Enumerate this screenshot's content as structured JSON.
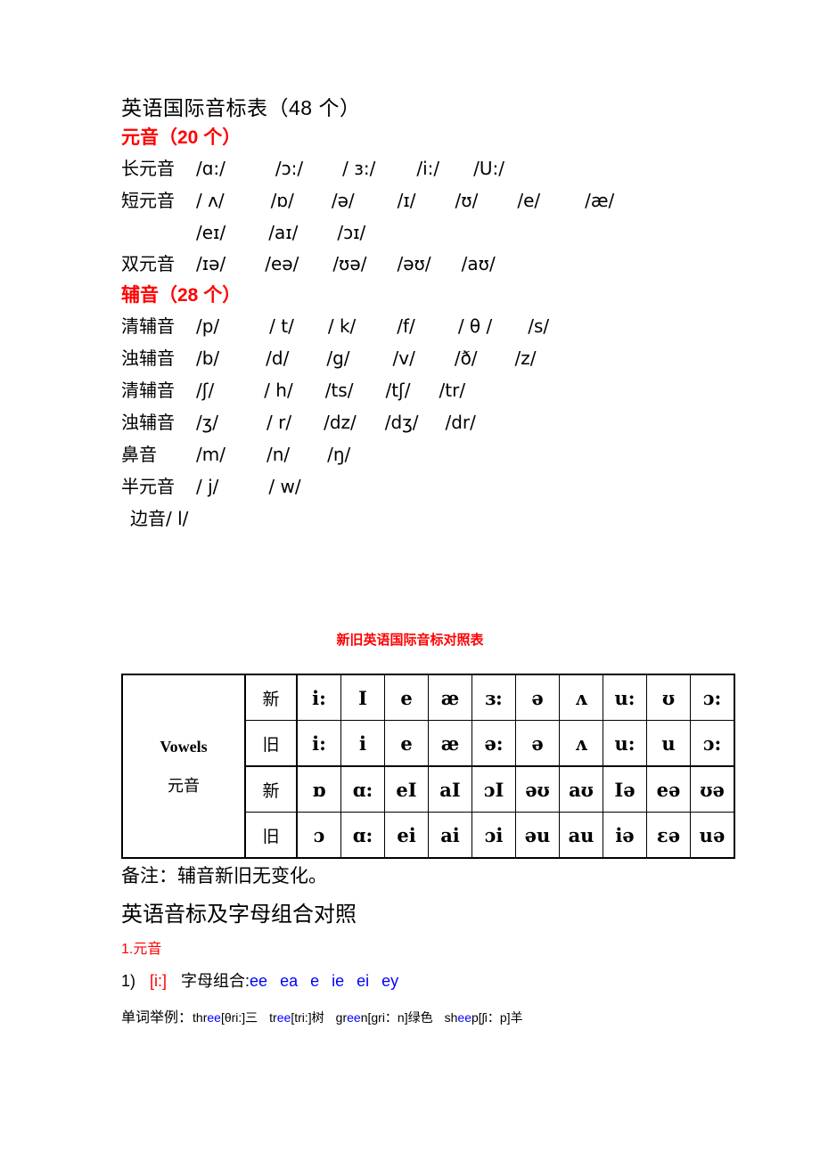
{
  "document": {
    "title": "英语国际音标表（48 个）",
    "vowels_heading": "元音（20 个）",
    "consonants_heading": "辅音（28 个）",
    "vowel_rows": [
      {
        "label": "长元音",
        "symbols": [
          "/ɑ:/",
          "/ɔ:/",
          "/ ɜ:/",
          "/i:/",
          "/U:/"
        ]
      },
      {
        "label": "短元音",
        "symbols": [
          "/ ʌ/",
          "/ɒ/",
          "/ə/",
          "/ɪ/",
          "/ʊ/",
          "/e/",
          "/æ/"
        ]
      },
      {
        "label": "",
        "symbols": [
          "/eɪ/",
          "/aɪ/",
          "/ɔɪ/"
        ]
      },
      {
        "label": "双元音",
        "symbols": [
          "/ɪə/",
          "/eə/",
          "/ʊə/",
          "/əʊ/",
          "/aʊ/"
        ]
      }
    ],
    "consonant_rows": [
      {
        "label": "清辅音",
        "symbols": [
          "/p/",
          "/ t/",
          "/ k/",
          "/f/",
          "/ θ /",
          "/s/"
        ]
      },
      {
        "label": "浊辅音",
        "symbols": [
          "/b/",
          "/d/",
          "/g/",
          "/v/",
          "/ð/",
          "/z/"
        ]
      },
      {
        "label": "清辅音",
        "symbols": [
          "/ʃ/",
          "/ h/",
          "/ts/",
          "/tʃ/",
          "/tr/"
        ]
      },
      {
        "label": "浊辅音",
        "symbols": [
          "/ʒ/",
          "/ r/",
          "/dz/",
          "/dʒ/",
          "/dr/"
        ]
      },
      {
        "label": "鼻音",
        "symbols": [
          "/m/",
          "/n/",
          "/ŋ/"
        ]
      },
      {
        "label": "半元音",
        "symbols": [
          "/ j/",
          "/ w/"
        ]
      },
      {
        "label": "边音",
        "symbols": [
          "/ l/"
        ]
      }
    ]
  },
  "comparison": {
    "title": "新旧英语国际音标对照表",
    "row_header_en": "Vowels",
    "row_header_cn": "元音",
    "era_new": "新",
    "era_old": "旧",
    "rows": [
      {
        "era": "新",
        "symbols": [
          "i:",
          "I",
          "e",
          "æ",
          "ɜ:",
          "ə",
          "ʌ",
          "u:",
          "ʊ",
          "ɔ:"
        ]
      },
      {
        "era": "旧",
        "symbols": [
          "i:",
          "i",
          "e",
          "æ",
          "ə:",
          "ə",
          "ʌ",
          "u:",
          "u",
          "ɔ:"
        ]
      },
      {
        "era": "新",
        "symbols": [
          "ɒ",
          "ɑ:",
          "eI",
          "aI",
          "ɔI",
          "əʊ",
          "aʊ",
          "Iə",
          "eə",
          "ʊə"
        ]
      },
      {
        "era": "旧",
        "symbols": [
          "ɔ",
          "ɑ:",
          "ei",
          "ai",
          "ɔi",
          "əu",
          "au",
          "iə",
          "ɛə",
          "uə"
        ]
      }
    ]
  },
  "footer": {
    "note": "备注：辅音新旧无变化。",
    "section_heading": "英语音标及字母组合对照",
    "list_index": "1.元音",
    "entry": {
      "number": "1)",
      "phoneme": "[i:]",
      "combo_label": "字母组合:",
      "combinations": [
        "ee",
        "ea",
        "e",
        "ie",
        "ei",
        "ey"
      ]
    },
    "examples_label": "单词举例：",
    "examples": [
      {
        "pre": "thr",
        "hi": "ee",
        "post": "",
        "phon": "[θri:]",
        "cn": "三"
      },
      {
        "pre": "tr",
        "hi": "ee",
        "post": "",
        "phon": "[tri:]",
        "cn": "树"
      },
      {
        "pre": "gr",
        "hi": "ee",
        "post": "n",
        "phon": "[gri：n]",
        "cn": "绿色"
      },
      {
        "pre": "sh",
        "hi": "ee",
        "post": "p",
        "phon": "[ʃi：p]",
        "cn": "羊"
      }
    ]
  },
  "colors": {
    "red": "#ff0000",
    "blue": "#0000ff",
    "black": "#000000"
  }
}
